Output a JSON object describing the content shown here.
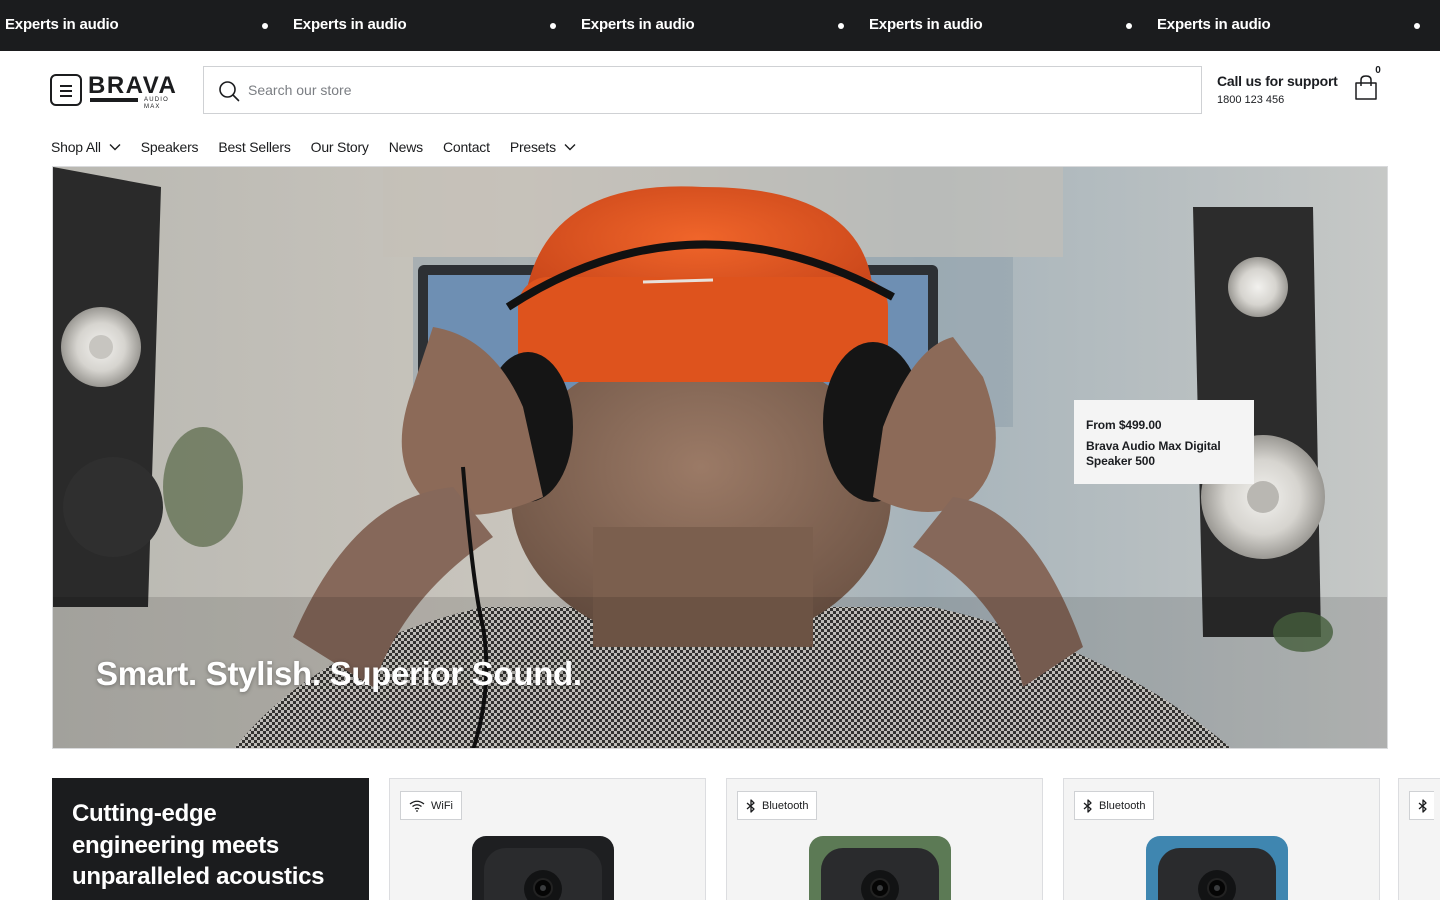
{
  "announcement": {
    "items": [
      "Experts in audio",
      "Experts in audio",
      "Experts in audio",
      "Experts in audio",
      "Experts in audio"
    ]
  },
  "header": {
    "logo_text": "BRAVA",
    "logo_subtext": "AUDIO MAX",
    "search_placeholder": "Search our store",
    "support_title": "Call us for support",
    "support_phone": "1800 123 456",
    "cart_count": "0"
  },
  "nav": {
    "items": [
      {
        "label": "Shop All",
        "dropdown": true
      },
      {
        "label": "Speakers",
        "dropdown": false
      },
      {
        "label": "Best Sellers",
        "dropdown": false
      },
      {
        "label": "Our Story",
        "dropdown": false
      },
      {
        "label": "News",
        "dropdown": false
      },
      {
        "label": "Contact",
        "dropdown": false
      },
      {
        "label": "Presets",
        "dropdown": true
      }
    ]
  },
  "hero": {
    "headline": "Smart. Stylish. Superior Sound.",
    "hotspot": {
      "price": "From $499.00",
      "product_name": "Brava Audio Max Digital Speaker 500"
    }
  },
  "products": {
    "promo_text": "Cutting-edge engineering meets unparalleled acoustics",
    "cards": [
      {
        "badge": "WiFi",
        "badge_icon": "wifi-icon",
        "color": "#1e1f21"
      },
      {
        "badge": "Bluetooth",
        "badge_icon": "bluetooth-icon",
        "color": "#5c7a55"
      },
      {
        "badge": "Bluetooth",
        "badge_icon": "bluetooth-icon",
        "color": "#3f86b0"
      },
      {
        "badge": "",
        "badge_icon": "bluetooth-icon",
        "color": "#1e1f21"
      }
    ]
  },
  "colors": {
    "ticker_bg": "#1b1c1e",
    "promo_bg": "#1b1c1e",
    "card_bg": "#f4f4f4",
    "hat": "#e2551f"
  }
}
